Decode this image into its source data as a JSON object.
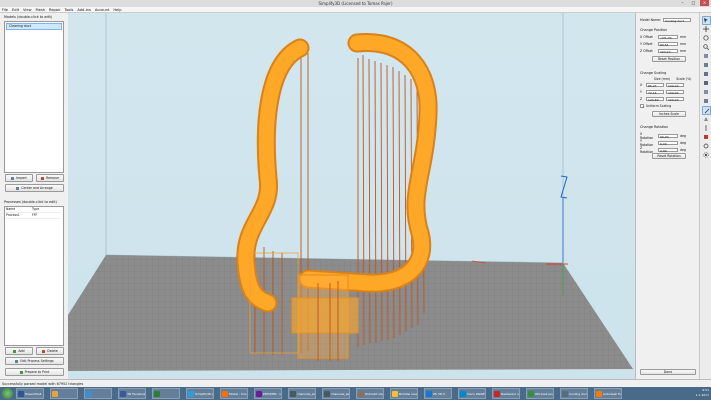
{
  "window": {
    "title": "Simplify3D (Licensed to Tomas Pajer)",
    "minimize": "–",
    "maximize": "□",
    "close": "✕"
  },
  "menu": [
    "File",
    "Edit",
    "View",
    "Mesh",
    "Repair",
    "Tools",
    "Add-Ins",
    "Account",
    "Help"
  ],
  "models_panel": {
    "label": "Models (double-click to edit)",
    "items": [
      "Cleaning duct"
    ],
    "import_label": "Import",
    "remove_label": "Remove",
    "center_label": "Center and Arrange"
  },
  "processes_panel": {
    "label": "Processes (double-click to edit)",
    "headers": [
      "Name",
      "Type"
    ],
    "rows": [
      {
        "name": "Process1",
        "type": "FFF"
      }
    ],
    "add_label": "Add",
    "delete_label": "Delete",
    "gcode_label": "Edit Process Settings",
    "prepare_label": "Prepare to Print"
  },
  "right_panel": {
    "model_name_label": "Model Name:",
    "model_name_value": "Cooling duct",
    "position_header": "Change Position",
    "x_offset_label": "X Offset",
    "x_offset_value": "-171,79",
    "y_offset_label": "Y Offset",
    "y_offset_value": "80,51",
    "z_offset_label": "Z Offset",
    "z_offset_value": "103,70",
    "unit_mm": "mm",
    "reset_position_label": "Reset Position",
    "scaling_header": "Change Scaling",
    "size_col": "Size (mm)",
    "scale_col": "Scale (%)",
    "scale_rows": [
      {
        "axis": "X",
        "size": "85,27",
        "scale": "100,00"
      },
      {
        "axis": "Y",
        "size": "72,14",
        "scale": "100,00"
      },
      {
        "axis": "Z",
        "size": "129,89",
        "scale": "100,00"
      }
    ],
    "uniform_label": "Uniform Scaling",
    "inches_label": "Inches Scale",
    "rotation_header": "Change Rotation",
    "x_rot_label": "X Rotation",
    "x_rot_value": "90,00",
    "y_rot_label": "Y Rotation",
    "y_rot_value": "0,00",
    "z_rot_label": "Z Rotation",
    "z_rot_value": "0,00",
    "unit_deg": "deg",
    "reset_rotation_label": "Reset Rotation",
    "done_label": "Done"
  },
  "status": {
    "text": "Successfully parsed model with 67952 triangles"
  },
  "taskbar": {
    "items": [
      {
        "label": "PowerShell",
        "color": "#2b5797"
      },
      {
        "label": "",
        "color": "#e8a33a"
      },
      {
        "label": "",
        "color": "#3a8fd8"
      },
      {
        "label": "3D Facebook",
        "color": "#3b5998"
      },
      {
        "label": "",
        "color": "#2e7d32"
      },
      {
        "label": "Simplify3D (Li...",
        "color": "#2aa0d8"
      },
      {
        "label": "Model - Cooling...",
        "color": "#ff6f00"
      },
      {
        "label": "PDH/MPA · Link...",
        "color": "#6a1b9a"
      },
      {
        "label": "channels_skills...",
        "color": "#455a64"
      },
      {
        "label": "channels_skills...",
        "color": "#455a64"
      },
      {
        "label": "Zobrazit obsah...",
        "color": "#8d6e63"
      },
      {
        "label": "Bohatsi soubor...",
        "color": "#fbc02d"
      },
      {
        "label": "ZS 3D.5",
        "color": "#1976d2"
      },
      {
        "label": "Cisco WebEx...",
        "color": "#0288d1"
      },
      {
        "label": "Nastaveni obr...",
        "color": "#c62828"
      },
      {
        "label": "Obrazek.png",
        "color": "#388e3c"
      },
      {
        "label": "Cooling duct ...",
        "color": "#546e7a"
      },
      {
        "label": "Autodesk Fusi...",
        "color": "#f57c00"
      }
    ],
    "tray_time": "9:51",
    "tray_date": "1.1.2017"
  },
  "colors": {
    "model": "#ffa726",
    "support": "#c0551a",
    "bed": "#8a8a8a",
    "viewport_bg": "#d0e5ec",
    "axis_x": "#e53935",
    "axis_y": "#43a047",
    "axis_z": "#1e63d6"
  }
}
